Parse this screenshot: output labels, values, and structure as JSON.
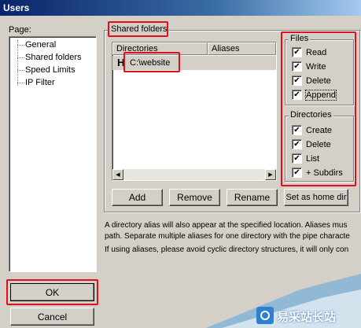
{
  "window": {
    "title": "Users"
  },
  "page_panel": {
    "label": "Page:",
    "items": [
      {
        "label": "General"
      },
      {
        "label": "Shared folders"
      },
      {
        "label": "Speed Limits"
      },
      {
        "label": "IP Filter"
      }
    ]
  },
  "shared_folders": {
    "legend": "Shared folders",
    "columns": {
      "directories": "Directories",
      "aliases": "Aliases"
    },
    "rows": [
      {
        "home_marker": "H",
        "directory": "C:\\website",
        "alias": ""
      }
    ],
    "buttons": {
      "add": "Add",
      "remove": "Remove",
      "rename": "Rename",
      "set_home": "Set as home dir"
    }
  },
  "files": {
    "legend": "Files",
    "options": [
      {
        "label": "Read",
        "checked": true
      },
      {
        "label": "Write",
        "checked": true
      },
      {
        "label": "Delete",
        "checked": true
      },
      {
        "label": "Append",
        "checked": true
      }
    ]
  },
  "directories": {
    "legend": "Directories",
    "options": [
      {
        "label": "Create",
        "checked": true
      },
      {
        "label": "Delete",
        "checked": true
      },
      {
        "label": "List",
        "checked": true
      },
      {
        "label": "+ Subdirs",
        "checked": true
      }
    ]
  },
  "description": {
    "line1": "A directory alias will also appear at the specified location. Aliases mus",
    "line2": "path. Separate multiple aliases for one directory with the pipe characte",
    "line3": "If using aliases, please avoid cyclic directory structures, it will only con"
  },
  "dialog_buttons": {
    "ok": "OK",
    "cancel": "Cancel"
  },
  "watermark": {
    "text": "易采站长站"
  },
  "colors": {
    "highlight": "#e0101a",
    "title_bar": "#0a246a",
    "face": "#d4d0c8"
  }
}
